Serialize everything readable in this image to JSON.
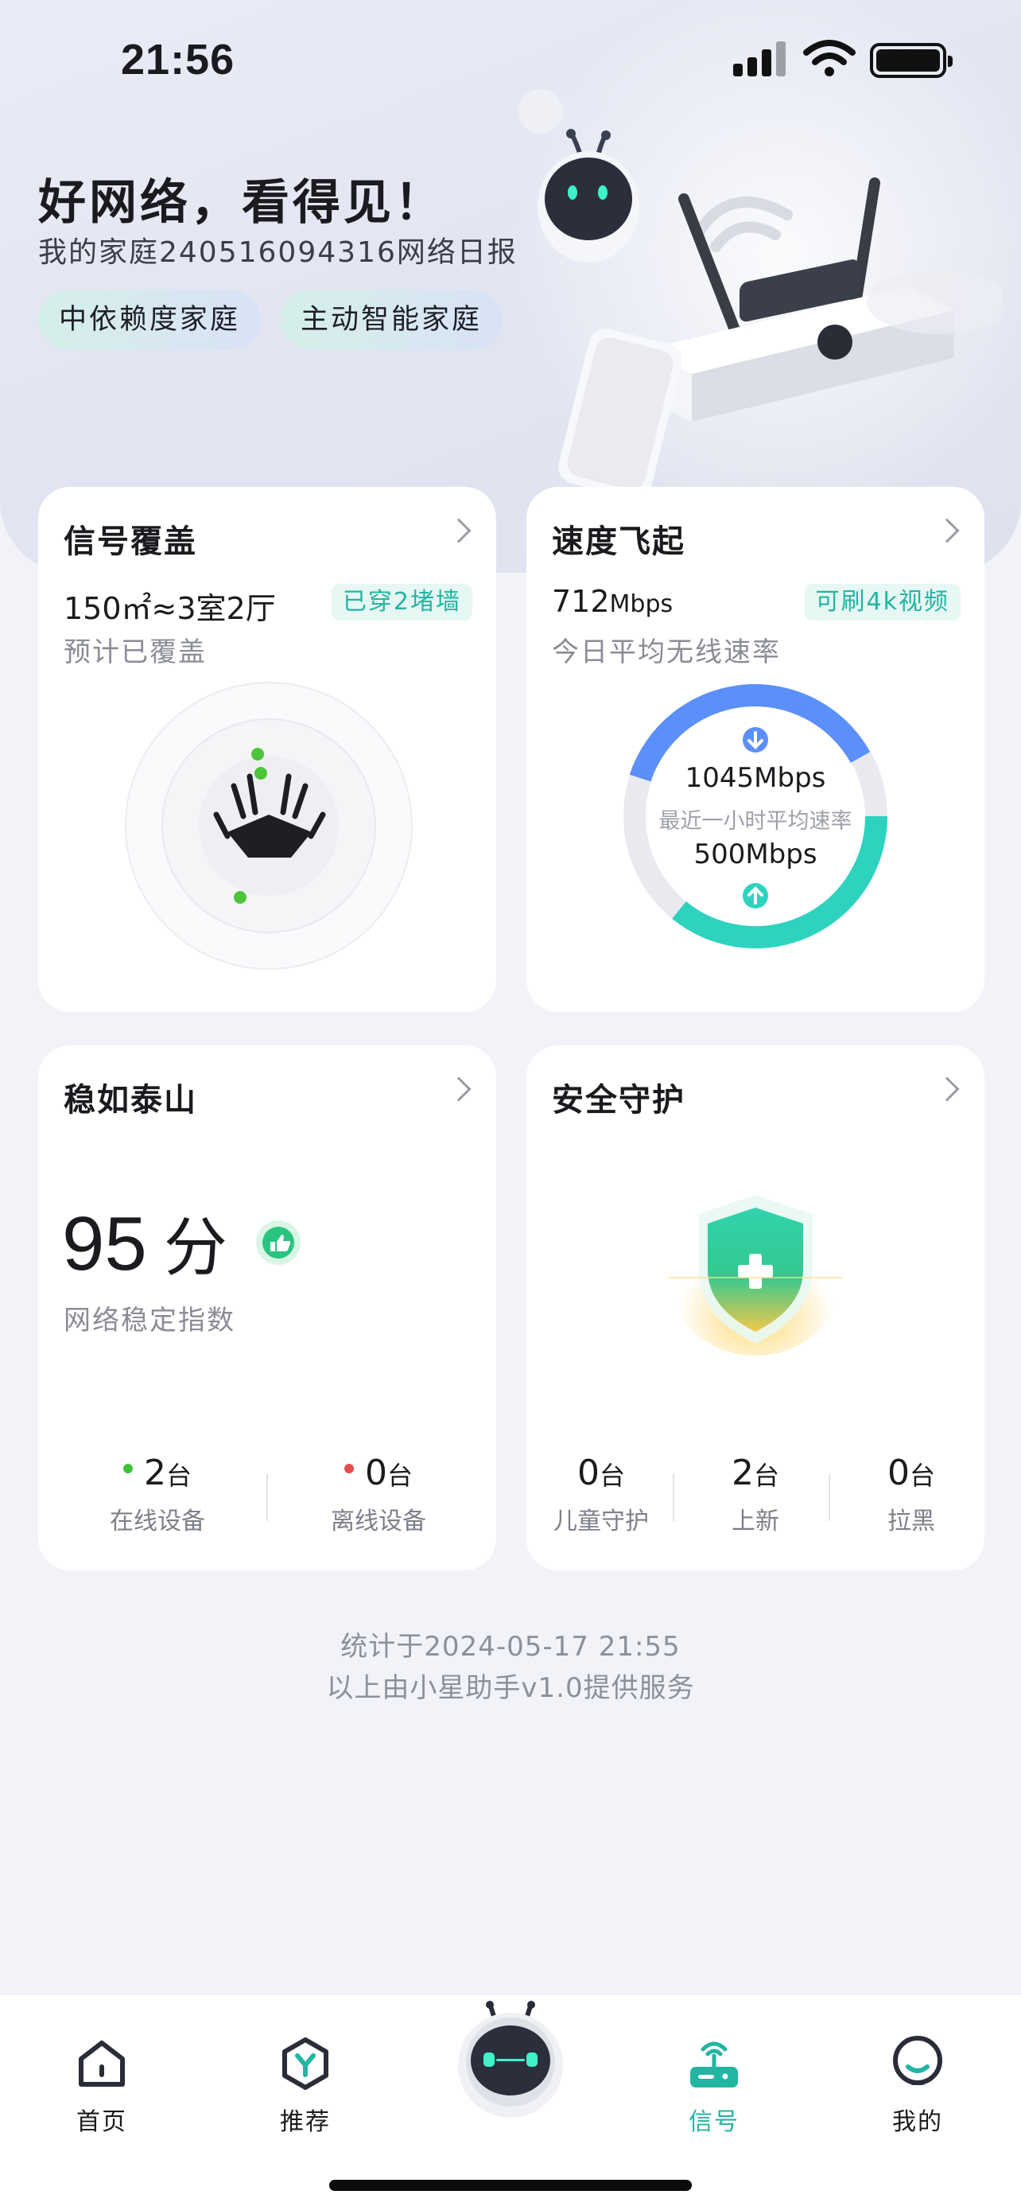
{
  "status_bar": {
    "time": "21:56"
  },
  "hero": {
    "title": "好网络，看得见！",
    "subtitle": "我的家庭240516094316网络日报",
    "tags": [
      "中依赖度家庭",
      "主动智能家庭"
    ]
  },
  "cards": {
    "coverage": {
      "title": "信号覆盖",
      "metric_value": "150㎡≈3室2厅",
      "badge": "已穿2堵墙",
      "caption": "预计已覆盖"
    },
    "speed": {
      "title": "速度飞起",
      "metric_value": "712",
      "metric_unit": "Mbps",
      "badge": "可刷4k视频",
      "caption": "今日平均无线速率",
      "download": "1045Mbps",
      "gauge_caption": "最近一小时平均速率",
      "upload": "500Mbps"
    },
    "stability": {
      "title": "稳如泰山",
      "score": "95",
      "score_unit": "分",
      "caption": "网络稳定指数",
      "online_count": "2",
      "online_unit": "台",
      "online_label": "在线设备",
      "offline_count": "0",
      "offline_unit": "台",
      "offline_label": "离线设备"
    },
    "security": {
      "title": "安全守护",
      "stats": [
        {
          "count": "0",
          "unit": "台",
          "label": "儿童守护"
        },
        {
          "count": "2",
          "unit": "台",
          "label": "上新"
        },
        {
          "count": "0",
          "unit": "台",
          "label": "拉黑"
        }
      ]
    }
  },
  "footer_meta": {
    "line1": "统计于2024-05-17  21:55",
    "line2": "以上由小星助手v1.0提供服务"
  },
  "tabbar": {
    "items": [
      {
        "label": "首页",
        "icon": "home-icon",
        "active": false
      },
      {
        "label": "推荐",
        "icon": "recommend-icon",
        "active": false
      },
      {
        "label": "",
        "icon": "robot-assistant-icon",
        "active": false
      },
      {
        "label": "信号",
        "icon": "router-signal-icon",
        "active": true
      },
      {
        "label": "我的",
        "icon": "profile-icon",
        "active": false
      }
    ]
  },
  "colors": {
    "accent": "#22b5a2",
    "download_ring": "#5b8ff9",
    "upload_ring": "#2ed3c0",
    "online_dot": "#3fc33b",
    "offline_dot": "#e84b4b"
  }
}
